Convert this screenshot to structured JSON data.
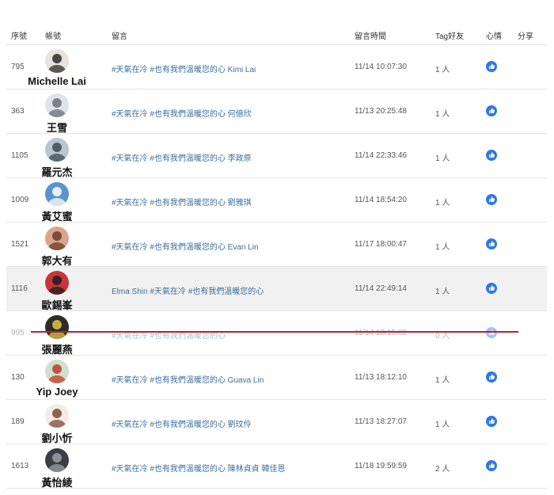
{
  "headers": {
    "index": "序號",
    "account": "帳號",
    "message": "留言",
    "time": "留言時間",
    "tag": "Tag好友",
    "mood": "心情",
    "share": "分享"
  },
  "like_icon": "thumbs-up-icon",
  "colors": {
    "like": "#2f77e6",
    "strike": "#b0262f",
    "message_link": "#3b6e99"
  },
  "rows": [
    {
      "index": "795",
      "name": "Michelle Lai",
      "message": "#天氣在冷 #也有我們溫暖您的心 Kimi Lai",
      "time": "11/14 10:07:30",
      "tag": "1 人"
    },
    {
      "index": "363",
      "name": "王雪",
      "message": "#天氣在冷 #也有我們溫暖您的心 何億欣",
      "time": "11/13 20:25:48",
      "tag": "1 人"
    },
    {
      "index": "1105",
      "name": "羅元杰",
      "message": "#天氣在冷 #也有我們溫暖您的心 李政原",
      "time": "11/14 22:33:46",
      "tag": "1 人"
    },
    {
      "index": "1009",
      "name": "黃艾蜜",
      "message": "#天氣在冷 #也有我們溫暖您的心 劉雅琪",
      "time": "11/14 18:54:20",
      "tag": "1 人"
    },
    {
      "index": "1521",
      "name": "郭大有",
      "message": "#天氣在冷 #也有我們溫暖您的心 Evan Lin",
      "time": "11/17 18:00:47",
      "tag": "1 人"
    },
    {
      "index": "1116",
      "name": "歐錫峯",
      "message": "Elma Shin #天氣在冷 #也有我們溫暖您的心",
      "time": "11/14 22:49:14",
      "tag": "1 人"
    },
    {
      "index": "995",
      "name": "張麗燕",
      "message": "#天氣在冷 #也有我們溫暖您的心",
      "time": "11/14 18:15:02",
      "tag": "0 人"
    },
    {
      "index": "130",
      "name": "Yip Joey",
      "message": "#天氣在冷 #也有我們溫暖您的心 Guava Lin",
      "time": "11/13 18:12:10",
      "tag": "1 人"
    },
    {
      "index": "189",
      "name": "劉小忻",
      "message": "#天氣在冷 #也有我們溫暖您的心 劉玟伶",
      "time": "11/13 18:27:07",
      "tag": "1 人"
    },
    {
      "index": "1613",
      "name": "黃怡綾",
      "message": "#天氣在冷 #也有我們溫暖您的心 陳林貞貞 韓佳恩",
      "time": "11/18 19:59:59",
      "tag": "2 人"
    }
  ]
}
